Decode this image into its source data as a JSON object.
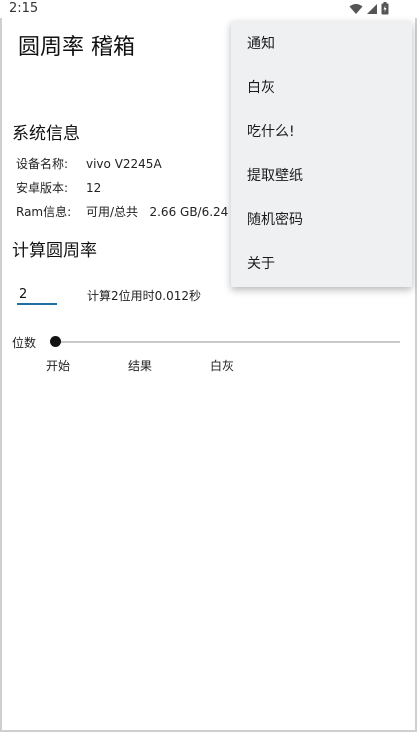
{
  "status_bar": {
    "time": "2:15",
    "icons": [
      "wifi-icon",
      "signal-icon",
      "battery-icon"
    ]
  },
  "app": {
    "title": "圆周率 稽箱"
  },
  "system_info": {
    "title": "系统信息",
    "rows": [
      {
        "label": "设备名称:",
        "value": "vivo V2245A"
      },
      {
        "label": "安卓版本:",
        "value": "12"
      },
      {
        "label": "Ram信息:",
        "value": "可用/总共   2.66 GB/6.24"
      }
    ]
  },
  "calc": {
    "title": "计算圆周率",
    "input_value": "2",
    "result_text": "计算2位用时0.012秒",
    "digits_label": "位数",
    "slider_value": 0,
    "buttons": {
      "start": "开始",
      "result": "结果",
      "gray": "白灰"
    }
  },
  "menu": {
    "items": [
      "通知",
      "白灰",
      "吃什么!",
      "提取壁纸",
      "随机密码",
      "关于"
    ]
  },
  "colors": {
    "menu_background": "#eef0f2",
    "input_underline": "#1f6fa3",
    "slider_track": "#c9c9c9",
    "slider_thumb": "#111111"
  }
}
